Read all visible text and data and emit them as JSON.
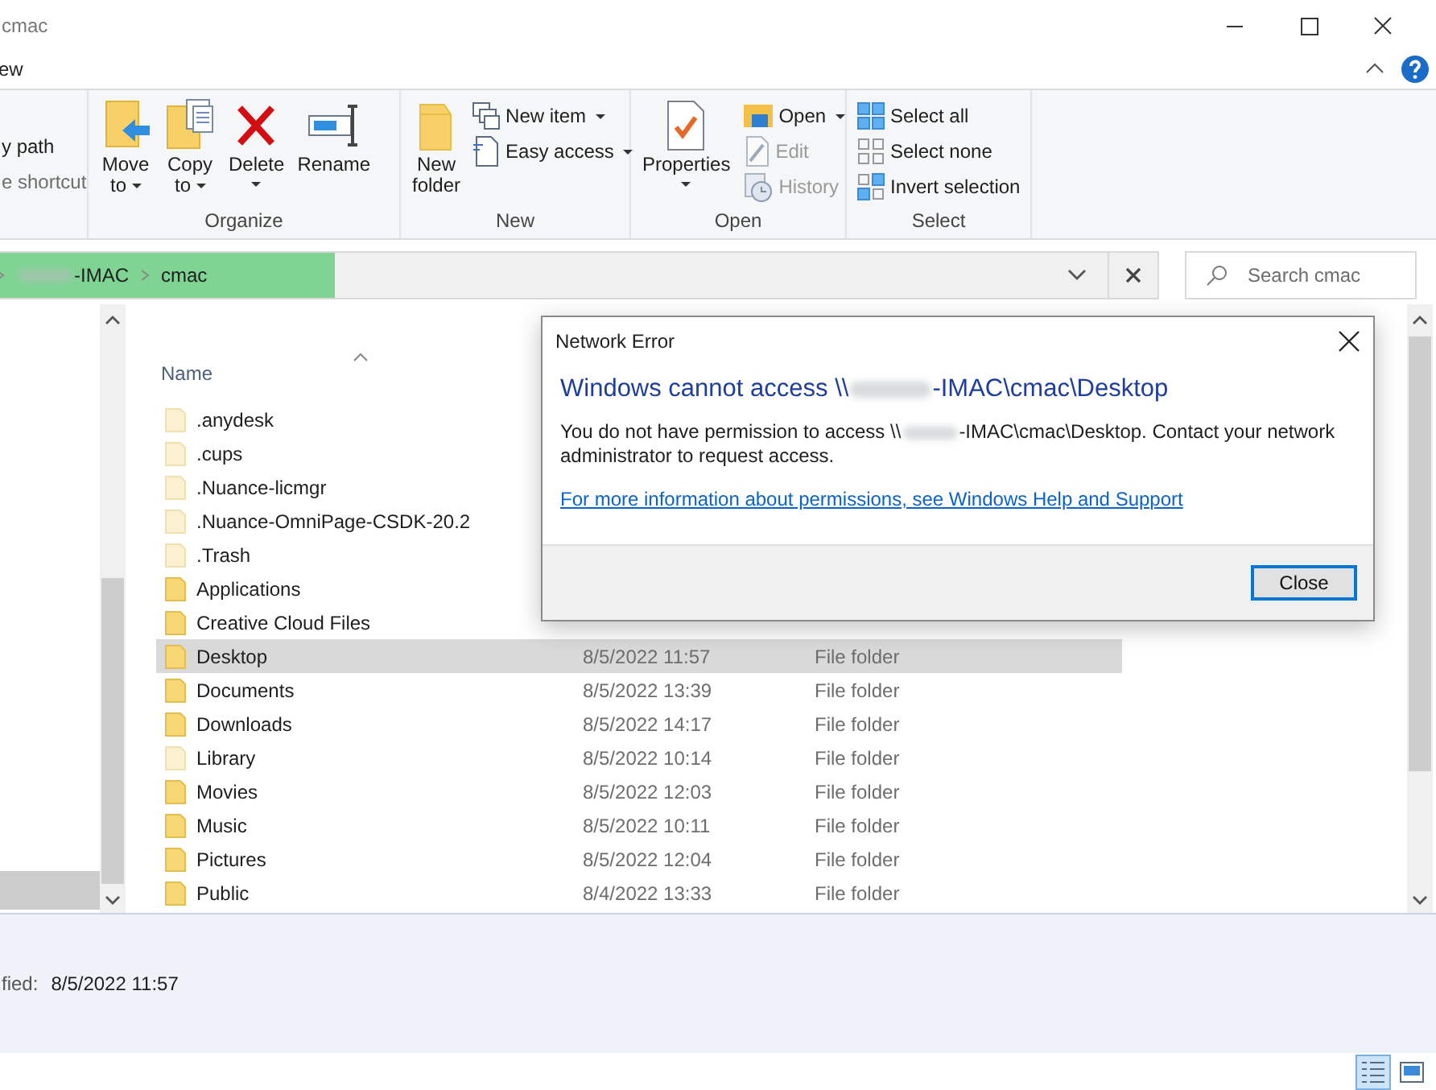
{
  "window": {
    "title": "cmac",
    "menu_tab": "ew"
  },
  "ribbon": {
    "partial_items": [
      "y path",
      "e shortcut"
    ],
    "groups": [
      {
        "label": "Organize",
        "items": [
          {
            "kind": "large",
            "label": "Move",
            "label2": "to",
            "dropdown": true
          },
          {
            "kind": "large",
            "label": "Copy",
            "label2": "to",
            "dropdown": true
          },
          {
            "kind": "large",
            "label": "Delete",
            "dropdown": true
          },
          {
            "kind": "large",
            "label": "Rename",
            "dropdown": false
          }
        ]
      },
      {
        "label": "New",
        "items": [
          {
            "kind": "large",
            "label": "New",
            "label2": "folder",
            "dropdown": false
          },
          {
            "kind": "small",
            "label": "New item",
            "dropdown": true,
            "disabled": false
          },
          {
            "kind": "small",
            "label": "Easy access",
            "dropdown": true,
            "disabled": false
          }
        ]
      },
      {
        "label": "Open",
        "items": [
          {
            "kind": "large",
            "label": "Properties",
            "dropdown": true
          },
          {
            "kind": "small",
            "label": "Open",
            "dropdown": true,
            "disabled": false
          },
          {
            "kind": "small",
            "label": "Edit",
            "dropdown": false,
            "disabled": true
          },
          {
            "kind": "small",
            "label": "History",
            "dropdown": false,
            "disabled": true
          }
        ]
      },
      {
        "label": "Select",
        "items": [
          {
            "kind": "small",
            "label": "Select all",
            "dropdown": false,
            "disabled": false
          },
          {
            "kind": "small",
            "label": "Select none",
            "dropdown": false,
            "disabled": false
          },
          {
            "kind": "small",
            "label": "Invert selection",
            "dropdown": false,
            "disabled": false
          }
        ]
      }
    ]
  },
  "address": {
    "segments": [
      {
        "text": "-IMAC",
        "redacted": true
      },
      {
        "text": "cmac",
        "redacted": false
      }
    ],
    "search": {
      "placeholder": "Search cmac"
    }
  },
  "file_list": {
    "columns": [
      "Name"
    ],
    "rows": [
      {
        "name": ".anydesk",
        "hidden": true,
        "selected": false
      },
      {
        "name": ".cups",
        "hidden": true,
        "selected": false
      },
      {
        "name": ".Nuance-licmgr",
        "hidden": true,
        "selected": false
      },
      {
        "name": ".Nuance-OmniPage-CSDK-20.2",
        "hidden": true,
        "selected": false
      },
      {
        "name": ".Trash",
        "hidden": true,
        "selected": false
      },
      {
        "name": "Applications",
        "hidden": false,
        "selected": false
      },
      {
        "name": "Creative Cloud Files",
        "hidden": false,
        "selected": false
      },
      {
        "name": "Desktop",
        "modified": "8/5/2022 11:57",
        "type": "File folder",
        "hidden": false,
        "selected": true
      },
      {
        "name": "Documents",
        "modified": "8/5/2022 13:39",
        "type": "File folder",
        "hidden": false,
        "selected": false
      },
      {
        "name": "Downloads",
        "modified": "8/5/2022 14:17",
        "type": "File folder",
        "hidden": false,
        "selected": false
      },
      {
        "name": "Library",
        "modified": "8/5/2022 10:14",
        "type": "File folder",
        "hidden": true,
        "selected": false
      },
      {
        "name": "Movies",
        "modified": "8/5/2022 12:03",
        "type": "File folder",
        "hidden": false,
        "selected": false
      },
      {
        "name": "Music",
        "modified": "8/5/2022 10:11",
        "type": "File folder",
        "hidden": false,
        "selected": false
      },
      {
        "name": "Pictures",
        "modified": "8/5/2022 12:04",
        "type": "File folder",
        "hidden": false,
        "selected": false
      },
      {
        "name": "Public",
        "modified": "8/4/2022 13:33",
        "type": "File folder",
        "hidden": false,
        "selected": false
      }
    ]
  },
  "details_pane": {
    "label": "fied:",
    "value": "8/5/2022 11:57"
  },
  "status_bar": {
    "views": [
      {
        "selected": true
      },
      {
        "selected": false
      }
    ]
  },
  "dialog": {
    "title": "Network Error",
    "heading_start": "Windows cannot access \\\\",
    "heading_end": "-IMAC\\cmac\\Desktop",
    "message_start": "You do not have permission to access \\\\",
    "message_end": "-IMAC\\cmac\\Desktop. Contact your network administrator to request access.",
    "link": "For more information about permissions, see Windows Help and Support",
    "button": "Close"
  }
}
